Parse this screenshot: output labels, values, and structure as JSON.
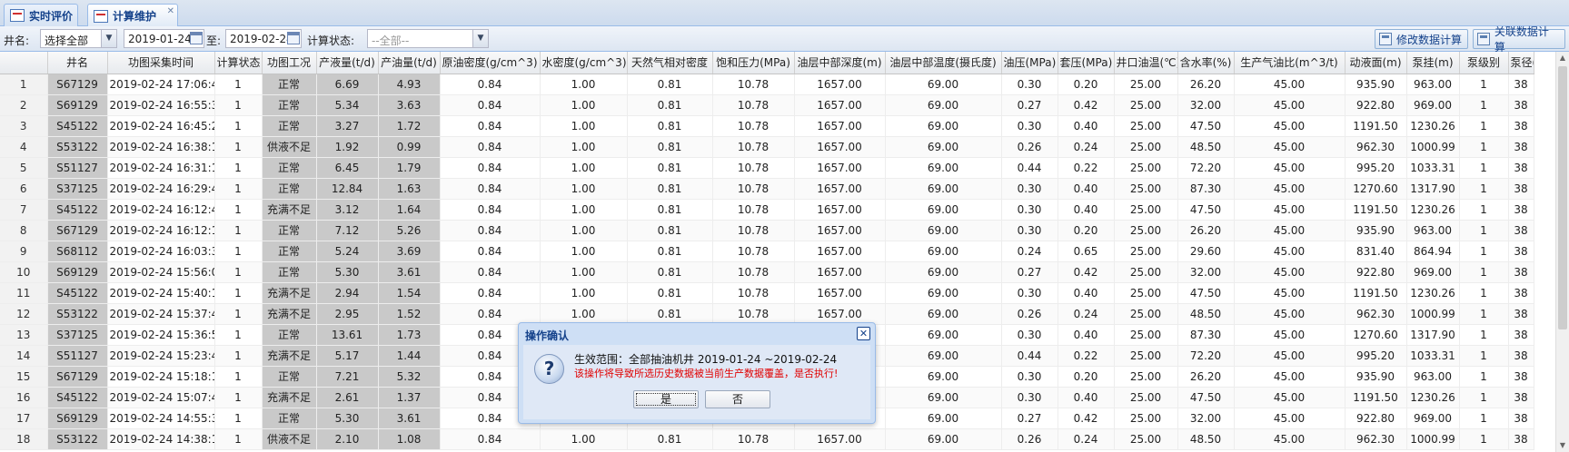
{
  "tabs": [
    {
      "label": "实时评价"
    },
    {
      "label": "计算维护",
      "active": true
    }
  ],
  "filters": {
    "well_label": "井名:",
    "well_value": "选择全部",
    "start_date": "2019-01-24",
    "to_label": "至:",
    "end_date": "2019-02-24",
    "status_label": "计算状态:",
    "status_value": "--全部--"
  },
  "actions": {
    "modify_calc": "修改数据计算",
    "related_calc": "关联数据计算"
  },
  "table": {
    "columns": [
      "",
      "井名",
      "功图采集时间",
      "计算状态",
      "功图工况",
      "产液量(t/d)",
      "产油量(t/d)",
      "原油密度(g/cm^3)",
      "水密度(g/cm^3)",
      "天然气相对密度",
      "饱和压力(MPa)",
      "油层中部深度(m)",
      "油层中部温度(摄氏度)",
      "油压(MPa)",
      "套压(MPa)",
      "井口油温(℃)",
      "含水率(%)",
      "生产气油比(m^3/t)",
      "动液面(m)",
      "泵挂(m)",
      "泵级别",
      "泵径(m"
    ],
    "rows": [
      [
        "1",
        "S67129",
        "2019-02-24 17:06:42",
        "1",
        "正常",
        "6.69",
        "4.93",
        "0.84",
        "1.00",
        "0.81",
        "10.78",
        "1657.00",
        "69.00",
        "0.30",
        "0.20",
        "25.00",
        "26.20",
        "45.00",
        "935.90",
        "963.00",
        "1",
        "38"
      ],
      [
        "2",
        "S69129",
        "2019-02-24 16:55:36",
        "1",
        "正常",
        "5.34",
        "3.63",
        "0.84",
        "1.00",
        "0.81",
        "10.78",
        "1657.00",
        "69.00",
        "0.27",
        "0.42",
        "25.00",
        "32.00",
        "45.00",
        "922.80",
        "969.00",
        "1",
        "38"
      ],
      [
        "3",
        "S45122",
        "2019-02-24 16:45:20",
        "1",
        "正常",
        "3.27",
        "1.72",
        "0.84",
        "1.00",
        "0.81",
        "10.78",
        "1657.00",
        "69.00",
        "0.30",
        "0.40",
        "25.00",
        "47.50",
        "45.00",
        "1191.50",
        "1230.26",
        "1",
        "38"
      ],
      [
        "4",
        "S53122",
        "2019-02-24 16:38:14",
        "1",
        "供液不足",
        "1.92",
        "0.99",
        "0.84",
        "1.00",
        "0.81",
        "10.78",
        "1657.00",
        "69.00",
        "0.26",
        "0.24",
        "25.00",
        "48.50",
        "45.00",
        "962.30",
        "1000.99",
        "1",
        "38"
      ],
      [
        "5",
        "S51127",
        "2019-02-24 16:31:15",
        "1",
        "正常",
        "6.45",
        "1.79",
        "0.84",
        "1.00",
        "0.81",
        "10.78",
        "1657.00",
        "69.00",
        "0.44",
        "0.22",
        "25.00",
        "72.20",
        "45.00",
        "995.20",
        "1033.31",
        "1",
        "38"
      ],
      [
        "6",
        "S37125",
        "2019-02-24 16:29:43",
        "1",
        "正常",
        "12.84",
        "1.63",
        "0.84",
        "1.00",
        "0.81",
        "10.78",
        "1657.00",
        "69.00",
        "0.30",
        "0.40",
        "25.00",
        "87.30",
        "45.00",
        "1270.60",
        "1317.90",
        "1",
        "38"
      ],
      [
        "7",
        "S45122",
        "2019-02-24 16:12:48",
        "1",
        "充满不足",
        "3.12",
        "1.64",
        "0.84",
        "1.00",
        "0.81",
        "10.78",
        "1657.00",
        "69.00",
        "0.30",
        "0.40",
        "25.00",
        "47.50",
        "45.00",
        "1191.50",
        "1230.26",
        "1",
        "38"
      ],
      [
        "8",
        "S67129",
        "2019-02-24 16:12:11",
        "1",
        "正常",
        "7.12",
        "5.26",
        "0.84",
        "1.00",
        "0.81",
        "10.78",
        "1657.00",
        "69.00",
        "0.30",
        "0.20",
        "25.00",
        "26.20",
        "45.00",
        "935.90",
        "963.00",
        "1",
        "38"
      ],
      [
        "9",
        "S68112",
        "2019-02-24 16:03:35",
        "1",
        "正常",
        "5.24",
        "3.69",
        "0.84",
        "1.00",
        "0.81",
        "10.78",
        "1657.00",
        "69.00",
        "0.24",
        "0.65",
        "25.00",
        "29.60",
        "45.00",
        "831.40",
        "864.94",
        "1",
        "38"
      ],
      [
        "10",
        "S69129",
        "2019-02-24 15:56:06",
        "1",
        "正常",
        "5.30",
        "3.61",
        "0.84",
        "1.00",
        "0.81",
        "10.78",
        "1657.00",
        "69.00",
        "0.27",
        "0.42",
        "25.00",
        "32.00",
        "45.00",
        "922.80",
        "969.00",
        "1",
        "38"
      ],
      [
        "11",
        "S45122",
        "2019-02-24 15:40:16",
        "1",
        "充满不足",
        "2.94",
        "1.54",
        "0.84",
        "1.00",
        "0.81",
        "10.78",
        "1657.00",
        "69.00",
        "0.30",
        "0.40",
        "25.00",
        "47.50",
        "45.00",
        "1191.50",
        "1230.26",
        "1",
        "38"
      ],
      [
        "12",
        "S53122",
        "2019-02-24 15:37:44",
        "1",
        "充满不足",
        "2.95",
        "1.52",
        "0.84",
        "1.00",
        "0.81",
        "10.78",
        "1657.00",
        "69.00",
        "0.26",
        "0.24",
        "25.00",
        "48.50",
        "45.00",
        "962.30",
        "1000.99",
        "1",
        "38"
      ],
      [
        "13",
        "S37125",
        "2019-02-24 15:36:54",
        "1",
        "正常",
        "13.61",
        "1.73",
        "0.84",
        "",
        "",
        "",
        "",
        "69.00",
        "0.30",
        "0.40",
        "25.00",
        "87.30",
        "45.00",
        "1270.60",
        "1317.90",
        "1",
        "38"
      ],
      [
        "14",
        "S51127",
        "2019-02-24 15:23:40",
        "1",
        "充满不足",
        "5.17",
        "1.44",
        "0.84",
        "",
        "",
        "",
        "",
        "69.00",
        "0.44",
        "0.22",
        "25.00",
        "72.20",
        "45.00",
        "995.20",
        "1033.31",
        "1",
        "38"
      ],
      [
        "15",
        "S67129",
        "2019-02-24 15:18:11",
        "1",
        "正常",
        "7.21",
        "5.32",
        "0.84",
        "",
        "",
        "",
        "",
        "69.00",
        "0.30",
        "0.20",
        "25.00",
        "26.20",
        "45.00",
        "935.90",
        "963.00",
        "1",
        "38"
      ],
      [
        "16",
        "S45122",
        "2019-02-24 15:07:45",
        "1",
        "充满不足",
        "2.61",
        "1.37",
        "0.84",
        "",
        "",
        "",
        "",
        "69.00",
        "0.30",
        "0.40",
        "25.00",
        "47.50",
        "45.00",
        "1191.50",
        "1230.26",
        "1",
        "38"
      ],
      [
        "17",
        "S69129",
        "2019-02-24 14:55:36",
        "1",
        "正常",
        "5.30",
        "3.61",
        "0.84",
        "",
        "",
        "",
        "",
        "69.00",
        "0.27",
        "0.42",
        "25.00",
        "32.00",
        "45.00",
        "922.80",
        "969.00",
        "1",
        "38"
      ],
      [
        "18",
        "S53122",
        "2019-02-24 14:38:13",
        "1",
        "供液不足",
        "2.10",
        "1.08",
        "0.84",
        "1.00",
        "0.81",
        "10.78",
        "1657.00",
        "69.00",
        "0.26",
        "0.24",
        "25.00",
        "48.50",
        "45.00",
        "962.30",
        "1000.99",
        "1",
        "38"
      ]
    ]
  },
  "dialog": {
    "title": "操作确认",
    "icon": "question-icon",
    "scope_text": "生效范围：全部抽油机井 2019-01-24 ~2019-02-24",
    "warning_text": "该操作将导致所选历史数据被当前生产数据覆盖，是否执行!",
    "yes_label": "是",
    "no_label": "否",
    "warning_color": "#e00000"
  }
}
